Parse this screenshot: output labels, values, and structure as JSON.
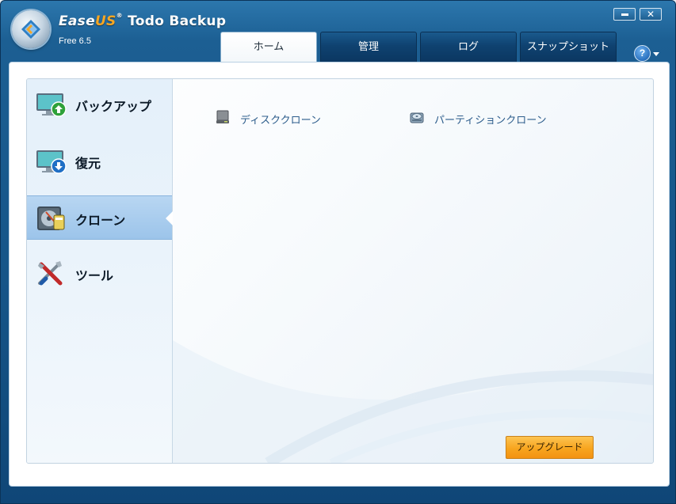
{
  "window": {
    "brand_ease": "Ease",
    "brand_us": "US",
    "registered": "®",
    "product": " Todo Backup",
    "version": "Free 6.5",
    "minimize_label": "–",
    "close_label": "✕",
    "help_label": "?"
  },
  "tabs": [
    {
      "label": "ホーム",
      "active": true
    },
    {
      "label": "管理",
      "active": false
    },
    {
      "label": "ログ",
      "active": false
    },
    {
      "label": "スナップショット",
      "active": false
    }
  ],
  "sidebar": {
    "items": [
      {
        "label": "バックアップ",
        "icon": "backup-monitor-icon",
        "active": false
      },
      {
        "label": "復元",
        "icon": "restore-monitor-icon",
        "active": false
      },
      {
        "label": "クローン",
        "icon": "clone-disk-icon",
        "active": true
      },
      {
        "label": "ツール",
        "icon": "tools-icon",
        "active": false
      }
    ]
  },
  "main": {
    "options": [
      {
        "label": "ディスククローン",
        "icon": "hard-disk-icon"
      },
      {
        "label": "パーティションクローン",
        "icon": "partition-disk-icon"
      }
    ],
    "upgrade_label": "アップグレード"
  },
  "colors": {
    "frame": "#155487",
    "accent": "#f6a623",
    "active_nav": "#9cc4ea",
    "link_text": "#2d5d8c",
    "upgrade": "#f7a51f"
  }
}
